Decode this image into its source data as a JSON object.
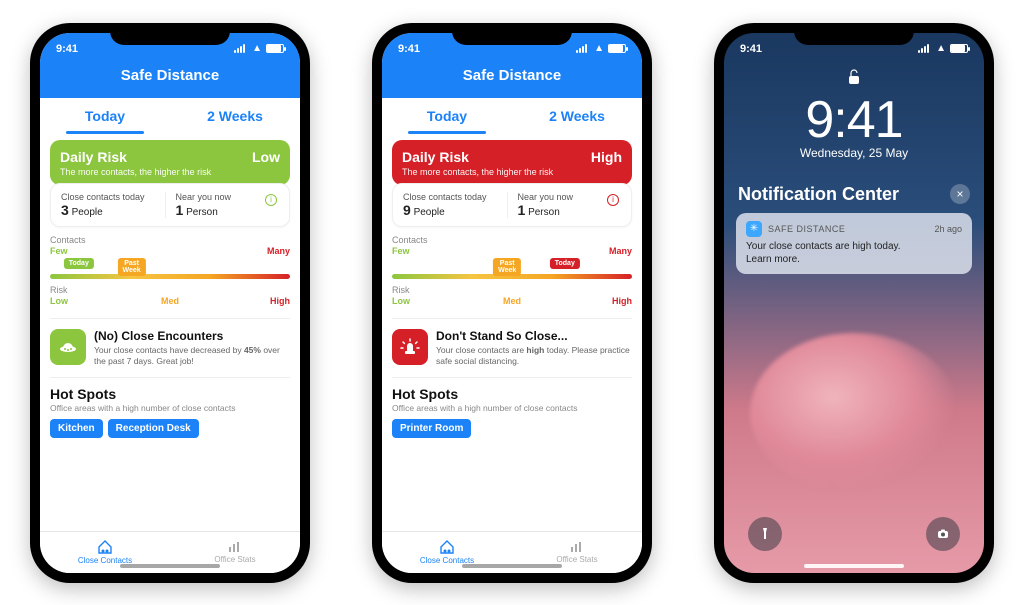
{
  "phones": [
    {
      "risk": "low",
      "status_time": "9:41",
      "app_title": "Safe Distance",
      "tabs": [
        "Today",
        "2 Weeks"
      ],
      "risk_card": {
        "title": "Daily Risk",
        "level": "Low",
        "subtitle": "The more contacts, the higher the risk"
      },
      "stats": {
        "close_label": "Close contacts today",
        "close_value": "3",
        "close_unit": "People",
        "near_label": "Near you now",
        "near_value": "1",
        "near_unit": "Person"
      },
      "gauge1": {
        "label": "Contacts",
        "left": "Few",
        "right": "Many",
        "markers": [
          {
            "text": "Today",
            "pos": 12,
            "color": "green"
          },
          {
            "text": "Past\nWeek",
            "pos": 34,
            "color": "orange"
          }
        ]
      },
      "gauge2": {
        "label": "Risk",
        "left": "Low",
        "mid": "Med",
        "right": "High"
      },
      "advice": {
        "title": "(No) Close Encounters",
        "body": "Your close contacts have decreased by 45% over the past 7 days. Great job!"
      },
      "hotspots": {
        "title": "Hot Spots",
        "subtitle": "Office areas with a high number of close contacts",
        "chips": [
          "Kitchen",
          "Reception Desk"
        ]
      },
      "tabbar": [
        "Close Contacts",
        "Office Stats"
      ]
    },
    {
      "risk": "high",
      "status_time": "9:41",
      "app_title": "Safe Distance",
      "tabs": [
        "Today",
        "2 Weeks"
      ],
      "risk_card": {
        "title": "Daily Risk",
        "level": "High",
        "subtitle": "The more contacts, the higher the risk"
      },
      "stats": {
        "close_label": "Close contacts today",
        "close_value": "9",
        "close_unit": "People",
        "near_label": "Near you now",
        "near_value": "1",
        "near_unit": "Person"
      },
      "gauge1": {
        "label": "Contacts",
        "left": "Few",
        "right": "Many",
        "markers": [
          {
            "text": "Past\nWeek",
            "pos": 48,
            "color": "orange"
          },
          {
            "text": "Today",
            "pos": 72,
            "color": "red"
          }
        ]
      },
      "gauge2": {
        "label": "Risk",
        "left": "Low",
        "mid": "Med",
        "right": "High"
      },
      "advice": {
        "title": "Don't Stand So Close...",
        "body": "Your close contacts are high today. Please practice safe social distancing."
      },
      "hotspots": {
        "title": "Hot Spots",
        "subtitle": "Office areas with a high number of close contacts",
        "chips": [
          "Printer Room"
        ]
      },
      "tabbar": [
        "Close Contacts",
        "Office Stats"
      ]
    }
  ],
  "lockscreen": {
    "status_time": "9:41",
    "time": "9:41",
    "date": "Wednesday, 25 May",
    "nc_title": "Notification Center",
    "notif": {
      "app": "SAFE DISTANCE",
      "time": "2h ago",
      "body": "Your close contacts are high today.\nLearn more."
    }
  }
}
